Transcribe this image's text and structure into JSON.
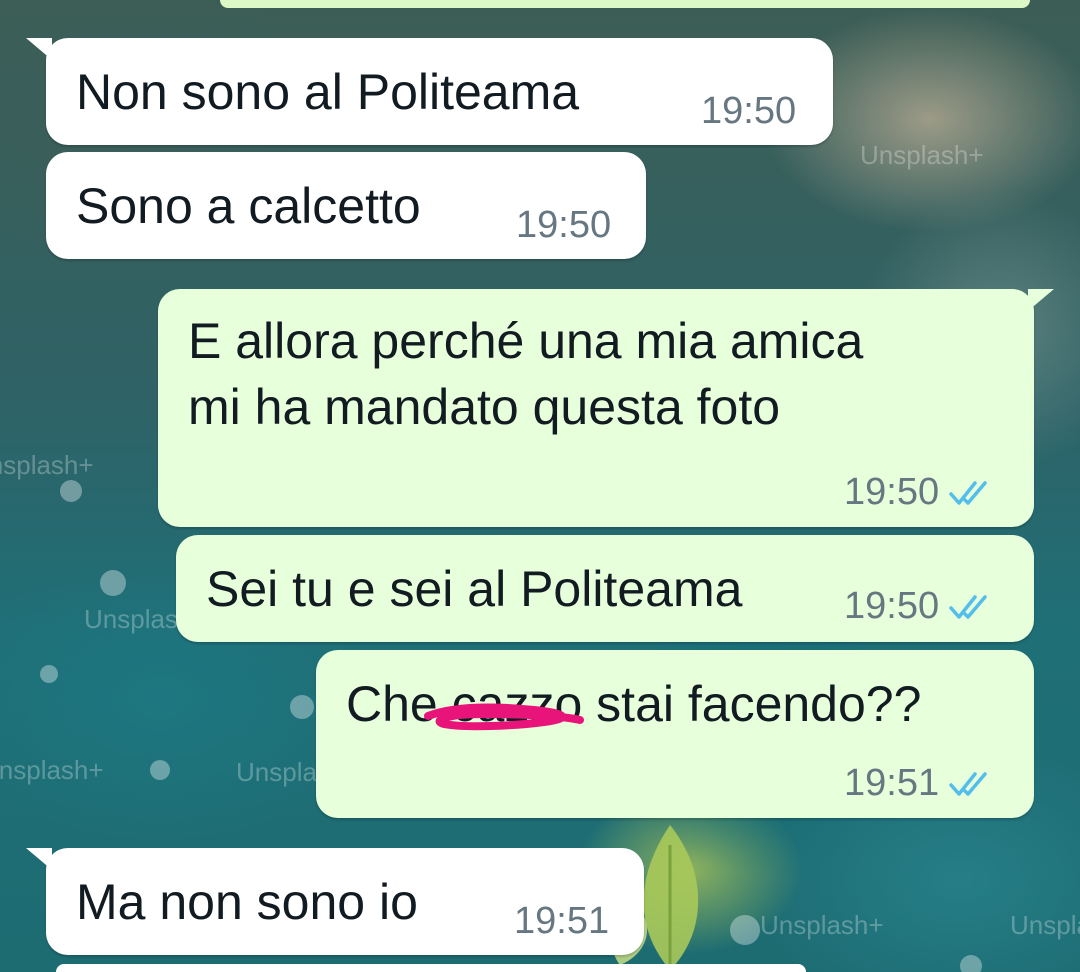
{
  "chat": {
    "messages": [
      {
        "direction": "incoming",
        "text": "Non sono al Politeama",
        "time": "19:50"
      },
      {
        "direction": "incoming",
        "text": "Sono a calcetto",
        "time": "19:50"
      },
      {
        "direction": "outgoing",
        "text_line1": "E allora perché una mia amica",
        "text_line2": "mi ha mandato questa foto",
        "time": "19:50",
        "status": "read-double-check-icon"
      },
      {
        "direction": "outgoing",
        "text": "Sei tu e sei al Politeama",
        "time": "19:50",
        "status": "read-double-check-icon"
      },
      {
        "direction": "outgoing",
        "text_before": "Che",
        "text_censored": "cazzo",
        "text_after": "stai facendo??",
        "time": "19:51",
        "status": "read-double-check-icon"
      },
      {
        "direction": "incoming",
        "text": "Ma non sono io",
        "time": "19:51"
      }
    ]
  },
  "wallpaper": {
    "watermark": "Unsplash+"
  },
  "colors": {
    "incoming_bubble": "#ffffff",
    "outgoing_bubble": "#e7ffdb",
    "read_ticks": "#53bdeb",
    "scribble": "#e8147a"
  }
}
